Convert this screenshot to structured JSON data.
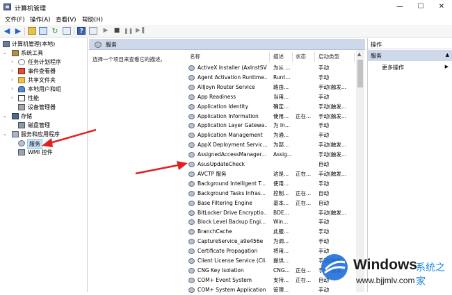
{
  "window": {
    "title": "计算机管理",
    "controls": {
      "minimize": "—",
      "maximize": "☐",
      "close": "✕"
    }
  },
  "menubar": [
    "文件(F)",
    "操作(A)",
    "查看(V)",
    "帮助(H)"
  ],
  "tree": {
    "root": "计算机管理(本地)",
    "system_tools": "系统工具",
    "task_scheduler": "任务计划程序",
    "event_viewer": "事件查看器",
    "shared_folders": "共享文件夹",
    "local_users": "本地用户和组",
    "performance": "性能",
    "device_manager": "设备管理器",
    "storage": "存储",
    "disk_management": "磁盘管理",
    "services_apps": "服务和应用程序",
    "services": "服务",
    "wmi": "WMI 控件"
  },
  "middle": {
    "header_title": "服务",
    "description": "选择一个项目来查看它的描述。",
    "columns": {
      "name": "名称",
      "desc": "描述",
      "status": "状态",
      "startup": "启动类型",
      "logon": "登"
    },
    "services": [
      {
        "name": "ActiveX Installer (AxInstSV)",
        "desc": "为从 ...",
        "status": "",
        "startup": "手动",
        "logon": "本"
      },
      {
        "name": "Agent Activation Runtime...",
        "desc": "Runt...",
        "status": "",
        "startup": "手动",
        "logon": "本"
      },
      {
        "name": "AllJoyn Router Service",
        "desc": "路由...",
        "status": "",
        "startup": "手动(触发...",
        "logon": "本"
      },
      {
        "name": "App Readiness",
        "desc": "当用...",
        "status": "",
        "startup": "手动",
        "logon": "本"
      },
      {
        "name": "Application Identity",
        "desc": "确定...",
        "status": "",
        "startup": "手动(触发...",
        "logon": "本"
      },
      {
        "name": "Application Information",
        "desc": "使用...",
        "status": "正在...",
        "startup": "手动(触发...",
        "logon": "本"
      },
      {
        "name": "Application Layer Gatewa...",
        "desc": "为 In...",
        "status": "",
        "startup": "手动",
        "logon": "本"
      },
      {
        "name": "Application Management",
        "desc": "为通...",
        "status": "",
        "startup": "手动",
        "logon": "本"
      },
      {
        "name": "AppX Deployment Servic...",
        "desc": "为部...",
        "status": "",
        "startup": "手动(触发...",
        "logon": "本"
      },
      {
        "name": "AssignedAccessManager...",
        "desc": "Assig...",
        "status": "",
        "startup": "手动(触发...",
        "logon": "本"
      },
      {
        "name": "AsusUpdateCheck",
        "desc": "",
        "status": "",
        "startup": "自动",
        "logon": "本"
      },
      {
        "name": "AVCTP 服务",
        "desc": "这是...",
        "status": "正在...",
        "startup": "手动(触发...",
        "logon": "本"
      },
      {
        "name": "Background Intelligent T...",
        "desc": "使用...",
        "status": "",
        "startup": "手动",
        "logon": "本"
      },
      {
        "name": "Background Tasks Infras...",
        "desc": "控制...",
        "status": "正在...",
        "startup": "自动",
        "logon": "本"
      },
      {
        "name": "Base Filtering Engine",
        "desc": "基本...",
        "status": "正在...",
        "startup": "自动",
        "logon": "本"
      },
      {
        "name": "BitLocker Drive Encryptio...",
        "desc": "BDE...",
        "status": "",
        "startup": "手动(触发...",
        "logon": "本"
      },
      {
        "name": "Block Level Backup Engi...",
        "desc": "Win...",
        "status": "",
        "startup": "手动",
        "logon": "本"
      },
      {
        "name": "BranchCache",
        "desc": "此服...",
        "status": "",
        "startup": "手动",
        "logon": "网"
      },
      {
        "name": "CaptureService_a9e456e",
        "desc": "为调...",
        "status": "",
        "startup": "手动",
        "logon": "本"
      },
      {
        "name": "Certificate Propagation",
        "desc": "将用...",
        "status": "",
        "startup": "手动",
        "logon": "本"
      },
      {
        "name": "Client License Service (Cli...",
        "desc": "提供...",
        "status": "",
        "startup": "手动(触发...",
        "logon": "本"
      },
      {
        "name": "CNG Key Isolation",
        "desc": "CNG...",
        "status": "正在...",
        "startup": "手动(触发...",
        "logon": "本"
      },
      {
        "name": "COM+ Event System",
        "desc": "支持...",
        "status": "正在...",
        "startup": "自动",
        "logon": "本"
      },
      {
        "name": "COM+ System Application",
        "desc": "管理...",
        "status": "",
        "startup": "手动",
        "logon": "本"
      }
    ]
  },
  "actions": {
    "header": "操作",
    "section": "服务",
    "more": "更多操作"
  },
  "watermark": {
    "title": "Windows",
    "cn": "系统之家",
    "url": "www.bjjmlv.com"
  },
  "colors": {
    "accent_red": "#e02020",
    "header_blue": "#cdd9ea",
    "selection": "#cce4f7"
  }
}
